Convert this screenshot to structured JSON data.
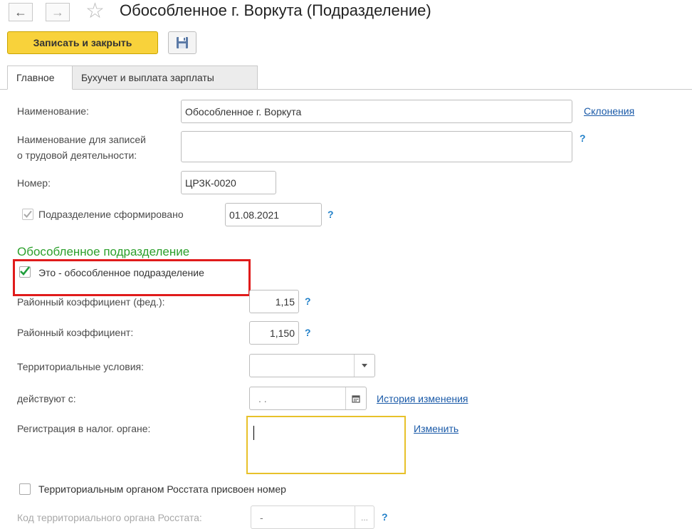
{
  "nav": {
    "back_glyph": "←",
    "forward_glyph": "→",
    "star_icon": "☆"
  },
  "window": {
    "title": "Обособленное г. Воркута (Подразделение)"
  },
  "toolbar": {
    "save_close_label": "Записать и закрыть",
    "save_icon": "floppy-disk-icon"
  },
  "tabs": [
    {
      "label": "Главное"
    },
    {
      "label": "Бухучет и выплата зарплаты"
    }
  ],
  "form": {
    "name_label": "Наименование:",
    "name_value": "Обособленное г. Воркута",
    "declensions_link": "Склонения",
    "employment_name_label_line1": "Наименование для записей",
    "employment_name_label_line2": "о трудовой деятельности:",
    "employment_name_value": "",
    "help_mark": "?",
    "number_label": "Номер:",
    "number_value": "ЦРЗК-0020",
    "formed_label": "Подразделение сформировано",
    "formed_checked": true,
    "formed_date": "01.08.2021"
  },
  "separate": {
    "section_title": "Обособленное подразделение",
    "is_separate_label": "Это - обособленное подразделение",
    "is_separate_checked": true,
    "regional_coef_fed_label": "Районный коэффициент (фед.):",
    "regional_coef_fed_value": "1,15",
    "regional_coef_label": "Районный коэффициент:",
    "regional_coef_value": "1,150",
    "territorial_label": "Территориальные условия:",
    "territorial_value": "",
    "valid_from_label": "действуют с:",
    "valid_from_value": " .  .",
    "history_link": "История изменения",
    "tax_reg_label": "Регистрация в налог. органе:",
    "tax_reg_value": "",
    "change_link": "Изменить",
    "rosstat_label": "Территориальным органом Росстата присвоен номер",
    "rosstat_checked": false,
    "rosstat_code_label": "Код территориального органа Росстата:",
    "rosstat_code_value": "-",
    "rosstat_select_glyph": "..."
  },
  "colors": {
    "accent": "#f8d23b",
    "section": "#2ca02c",
    "link": "#1a5aa8",
    "highlight": "#e01b1b",
    "focus": "#e8c12a"
  }
}
